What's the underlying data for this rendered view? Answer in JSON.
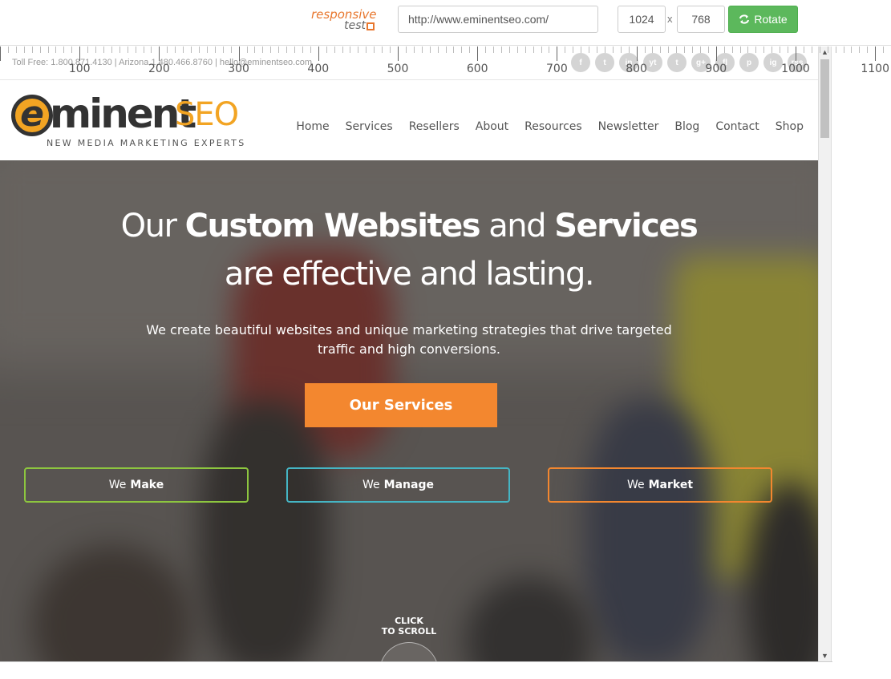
{
  "toolbar": {
    "logo_line1": "responsive",
    "logo_line2": "test",
    "url": "http://www.eminentseo.com/",
    "width": "1024",
    "height": "768",
    "times": "x",
    "rotate_label": "Rotate"
  },
  "ruler": {
    "labels": [
      "100",
      "200",
      "300",
      "400",
      "500",
      "600",
      "700",
      "800",
      "900",
      "1000",
      "1100"
    ]
  },
  "site": {
    "topbar": {
      "contact": "Toll Free: 1.800.871.4130 | Arizona 1.480.466.8760 | hello@eminentseo.com",
      "social": [
        "f",
        "t",
        "in",
        "yt",
        "t",
        "g+",
        "fl",
        "p",
        "ig",
        "rss"
      ]
    },
    "logo": {
      "e": "e",
      "minent": "minent",
      "seo": "SEO",
      "tagline": "NEW MEDIA MARKETING EXPERTS"
    },
    "nav": [
      "Home",
      "Services",
      "Resellers",
      "About",
      "Resources",
      "Newsletter",
      "Blog",
      "Contact",
      "Shop"
    ],
    "hero": {
      "h1_part1": "Our ",
      "h1_bold1": "Custom Websites",
      "h1_part2": " and ",
      "h1_bold2": "Services",
      "h1_line2": "are effective and lasting.",
      "lead": "We create beautiful websites and unique marketing strategies that drive targeted traffic and high conversions.",
      "cta": "Our Services",
      "pill_we": "We",
      "pill_make": "Make",
      "pill_manage": "Manage",
      "pill_market": "Market",
      "scroll_line1": "Click",
      "scroll_line2": "to scroll"
    }
  },
  "colors": {
    "orange": "#f3872f",
    "logo_orange": "#f2a423",
    "green": "#5cb85c",
    "make_border": "#8dc63f",
    "manage_border": "#45b5c4"
  }
}
